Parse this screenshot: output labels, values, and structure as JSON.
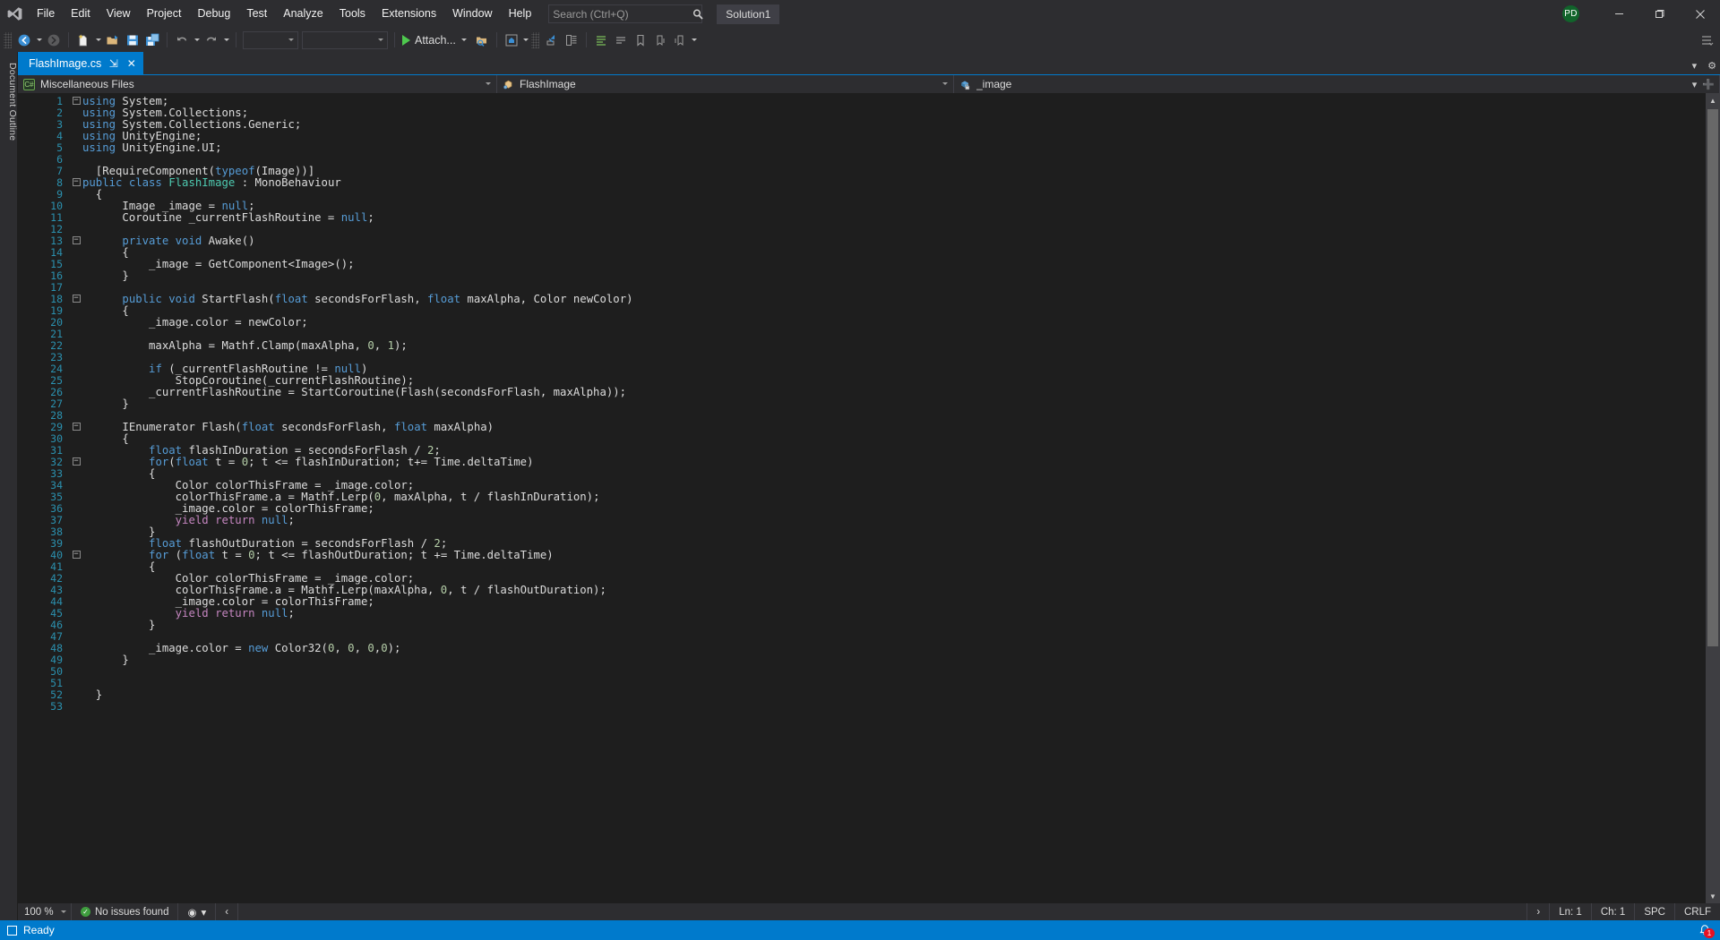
{
  "window": {
    "title": "Solution1",
    "user_initials": "PD",
    "minimize": "─",
    "maximize": "❐",
    "close": "✕"
  },
  "menu": {
    "items": [
      "File",
      "Edit",
      "View",
      "Project",
      "Debug",
      "Test",
      "Analyze",
      "Tools",
      "Extensions",
      "Window",
      "Help"
    ]
  },
  "search": {
    "placeholder": "Search (Ctrl+Q)",
    "value": ""
  },
  "toolbar": {
    "navigate_back": "navigate-backward",
    "navigate_forward": "navigate-forward",
    "new_project": "new-project",
    "open_file": "open-file",
    "save": "save",
    "save_all": "save-all",
    "undo": "undo",
    "redo": "redo",
    "combo1": "",
    "combo2": "",
    "attach_label": "Attach...",
    "hot_reload": "hot-reload",
    "preview": "preview-selected-items",
    "solution_explorer": "solution-explorer",
    "properties": "properties-window",
    "toolbox": "toolbox"
  },
  "tabs": [
    {
      "label": "FlashImage.cs",
      "pin": "⇲",
      "close": "✕",
      "active": true
    }
  ],
  "navbar": {
    "project": "Miscellaneous Files",
    "type": "FlashImage",
    "member": "_image"
  },
  "editor": {
    "lines": [
      {
        "n": 1,
        "fold": "minus",
        "tokens": [
          [
            "k",
            "using"
          ],
          [
            "w",
            " System;"
          ]
        ]
      },
      {
        "n": 2,
        "fold": "bar",
        "tokens": [
          [
            "k",
            "using"
          ],
          [
            "w",
            " System.Collections;"
          ]
        ]
      },
      {
        "n": 3,
        "fold": "bar",
        "tokens": [
          [
            "k",
            "using"
          ],
          [
            "w",
            " System.Collections.Generic;"
          ]
        ]
      },
      {
        "n": 4,
        "fold": "bar",
        "tokens": [
          [
            "k",
            "using"
          ],
          [
            "w",
            " UnityEngine;"
          ]
        ]
      },
      {
        "n": 5,
        "fold": "barend",
        "tokens": [
          [
            "k",
            "using"
          ],
          [
            "w",
            " UnityEngine.UI;"
          ]
        ]
      },
      {
        "n": 6,
        "fold": "",
        "tokens": []
      },
      {
        "n": 7,
        "fold": "",
        "tokens": [
          [
            "w",
            "  [RequireComponent("
          ],
          [
            "k",
            "typeof"
          ],
          [
            "w",
            "(Image))]"
          ]
        ]
      },
      {
        "n": 8,
        "fold": "minus",
        "tokens": [
          [
            "k",
            "public class "
          ],
          [
            "t",
            "FlashImage"
          ],
          [
            "w",
            " : MonoBehaviour"
          ]
        ]
      },
      {
        "n": 9,
        "fold": "",
        "tokens": [
          [
            "w",
            "  {"
          ]
        ]
      },
      {
        "n": 10,
        "fold": "",
        "tokens": [
          [
            "w",
            "      Image _image = "
          ],
          [
            "k",
            "null"
          ],
          [
            "w",
            ";"
          ]
        ]
      },
      {
        "n": 11,
        "fold": "",
        "tokens": [
          [
            "w",
            "      Coroutine _currentFlashRoutine = "
          ],
          [
            "k",
            "null"
          ],
          [
            "w",
            ";"
          ]
        ]
      },
      {
        "n": 12,
        "fold": "",
        "tokens": []
      },
      {
        "n": 13,
        "fold": "minus",
        "tokens": [
          [
            "k",
            "      private void "
          ],
          [
            "w",
            "Awake()"
          ]
        ]
      },
      {
        "n": 14,
        "fold": "",
        "tokens": [
          [
            "w",
            "      {"
          ]
        ]
      },
      {
        "n": 15,
        "fold": "",
        "tokens": [
          [
            "w",
            "          _image = GetComponent<Image>();"
          ]
        ]
      },
      {
        "n": 16,
        "fold": "",
        "tokens": [
          [
            "w",
            "      }"
          ]
        ]
      },
      {
        "n": 17,
        "fold": "",
        "tokens": []
      },
      {
        "n": 18,
        "fold": "minus",
        "tokens": [
          [
            "k",
            "      public void "
          ],
          [
            "w",
            "StartFlash("
          ],
          [
            "k",
            "float"
          ],
          [
            "w",
            " secondsForFlash, "
          ],
          [
            "k",
            "float"
          ],
          [
            "w",
            " maxAlpha, Color newColor)"
          ]
        ]
      },
      {
        "n": 19,
        "fold": "",
        "tokens": [
          [
            "w",
            "      {"
          ]
        ]
      },
      {
        "n": 20,
        "fold": "",
        "tokens": [
          [
            "w",
            "          _image.color = newColor;"
          ]
        ]
      },
      {
        "n": 21,
        "fold": "",
        "tokens": []
      },
      {
        "n": 22,
        "fold": "",
        "tokens": [
          [
            "w",
            "          maxAlpha = Mathf.Clamp(maxAlpha, "
          ],
          [
            "n",
            "0"
          ],
          [
            "w",
            ", "
          ],
          [
            "n",
            "1"
          ],
          [
            "w",
            ");"
          ]
        ]
      },
      {
        "n": 23,
        "fold": "",
        "tokens": []
      },
      {
        "n": 24,
        "fold": "",
        "tokens": [
          [
            "w",
            "          "
          ],
          [
            "k",
            "if"
          ],
          [
            "w",
            " (_currentFlashRoutine != "
          ],
          [
            "k",
            "null"
          ],
          [
            "w",
            ")"
          ]
        ]
      },
      {
        "n": 25,
        "fold": "",
        "tokens": [
          [
            "w",
            "              StopCoroutine(_currentFlashRoutine);"
          ]
        ]
      },
      {
        "n": 26,
        "fold": "",
        "tokens": [
          [
            "w",
            "          _currentFlashRoutine = StartCoroutine(Flash(secondsForFlash, maxAlpha));"
          ]
        ]
      },
      {
        "n": 27,
        "fold": "",
        "tokens": [
          [
            "w",
            "      }"
          ]
        ]
      },
      {
        "n": 28,
        "fold": "",
        "tokens": []
      },
      {
        "n": 29,
        "fold": "minus",
        "tokens": [
          [
            "w",
            "      IEnumerator Flash("
          ],
          [
            "k",
            "float"
          ],
          [
            "w",
            " secondsForFlash, "
          ],
          [
            "k",
            "float"
          ],
          [
            "w",
            " maxAlpha)"
          ]
        ]
      },
      {
        "n": 30,
        "fold": "",
        "tokens": [
          [
            "w",
            "      {"
          ]
        ]
      },
      {
        "n": 31,
        "fold": "",
        "tokens": [
          [
            "w",
            "          "
          ],
          [
            "k",
            "float"
          ],
          [
            "w",
            " flashInDuration = secondsForFlash / "
          ],
          [
            "n",
            "2"
          ],
          [
            "w",
            ";"
          ]
        ]
      },
      {
        "n": 32,
        "fold": "minus",
        "tokens": [
          [
            "w",
            "          "
          ],
          [
            "k",
            "for"
          ],
          [
            "w",
            "("
          ],
          [
            "k",
            "float"
          ],
          [
            "w",
            " t = "
          ],
          [
            "n",
            "0"
          ],
          [
            "w",
            "; t <= flashInDuration; t+= Time.deltaTime)"
          ]
        ]
      },
      {
        "n": 33,
        "fold": "",
        "tokens": [
          [
            "w",
            "          {"
          ]
        ]
      },
      {
        "n": 34,
        "fold": "",
        "tokens": [
          [
            "w",
            "              Color colorThisFrame = _image.color;"
          ]
        ]
      },
      {
        "n": 35,
        "fold": "",
        "tokens": [
          [
            "w",
            "              colorThisFrame.a = Mathf.Lerp("
          ],
          [
            "n",
            "0"
          ],
          [
            "w",
            ", maxAlpha, t / flashInDuration);"
          ]
        ]
      },
      {
        "n": 36,
        "fold": "",
        "tokens": [
          [
            "w",
            "              _image.color = colorThisFrame;"
          ]
        ]
      },
      {
        "n": 37,
        "fold": "",
        "tokens": [
          [
            "w",
            "              "
          ],
          [
            "p",
            "yield return "
          ],
          [
            "k",
            "null"
          ],
          [
            "w",
            ";"
          ]
        ]
      },
      {
        "n": 38,
        "fold": "",
        "tokens": [
          [
            "w",
            "          }"
          ]
        ]
      },
      {
        "n": 39,
        "fold": "",
        "tokens": [
          [
            "w",
            "          "
          ],
          [
            "k",
            "float"
          ],
          [
            "w",
            " flashOutDuration = secondsForFlash / "
          ],
          [
            "n",
            "2"
          ],
          [
            "w",
            ";"
          ]
        ]
      },
      {
        "n": 40,
        "fold": "minus",
        "tokens": [
          [
            "w",
            "          "
          ],
          [
            "k",
            "for"
          ],
          [
            "w",
            " ("
          ],
          [
            "k",
            "float"
          ],
          [
            "w",
            " t = "
          ],
          [
            "n",
            "0"
          ],
          [
            "w",
            "; t <= flashOutDuration; t += Time.deltaTime)"
          ]
        ]
      },
      {
        "n": 41,
        "fold": "",
        "tokens": [
          [
            "w",
            "          {"
          ]
        ]
      },
      {
        "n": 42,
        "fold": "",
        "tokens": [
          [
            "w",
            "              Color colorThisFrame = _image.color;"
          ]
        ]
      },
      {
        "n": 43,
        "fold": "",
        "tokens": [
          [
            "w",
            "              colorThisFrame.a = Mathf.Lerp(maxAlpha, "
          ],
          [
            "n",
            "0"
          ],
          [
            "w",
            ", t / flashOutDuration);"
          ]
        ]
      },
      {
        "n": 44,
        "fold": "",
        "tokens": [
          [
            "w",
            "              _image.color = colorThisFrame;"
          ]
        ]
      },
      {
        "n": 45,
        "fold": "",
        "tokens": [
          [
            "w",
            "              "
          ],
          [
            "p",
            "yield return "
          ],
          [
            "k",
            "null"
          ],
          [
            "w",
            ";"
          ]
        ]
      },
      {
        "n": 46,
        "fold": "",
        "tokens": [
          [
            "w",
            "          }"
          ]
        ]
      },
      {
        "n": 47,
        "fold": "",
        "tokens": []
      },
      {
        "n": 48,
        "fold": "",
        "tokens": [
          [
            "w",
            "          _image.color = "
          ],
          [
            "k",
            "new"
          ],
          [
            "w",
            " Color32("
          ],
          [
            "n",
            "0"
          ],
          [
            "w",
            ", "
          ],
          [
            "n",
            "0"
          ],
          [
            "w",
            ", "
          ],
          [
            "n",
            "0"
          ],
          [
            "w",
            ","
          ],
          [
            "n",
            "0"
          ],
          [
            "w",
            ");"
          ]
        ]
      },
      {
        "n": 49,
        "fold": "",
        "tokens": [
          [
            "w",
            "      }"
          ]
        ]
      },
      {
        "n": 50,
        "fold": "",
        "tokens": []
      },
      {
        "n": 51,
        "fold": "",
        "tokens": []
      },
      {
        "n": 52,
        "fold": "",
        "tokens": [
          [
            "w",
            "  }"
          ]
        ]
      },
      {
        "n": 53,
        "fold": "",
        "tokens": []
      }
    ]
  },
  "edit_status": {
    "zoom": "100 %",
    "issues": "No issues found",
    "line": "Ln: 1",
    "col": "Ch: 1",
    "spaces": "SPC",
    "eol": "CRLF"
  },
  "statusbar": {
    "ready": "Ready",
    "notification_count": "1"
  },
  "left_rail": {
    "document_outline": "Document Outline"
  },
  "colors": {
    "accent": "#007acc",
    "chrome": "#2d2d30",
    "editor_bg": "#1e1e1e",
    "keyword": "#569cd6",
    "type": "#4ec9b0",
    "linenum": "#2b91af",
    "control": "#c586c0",
    "number": "#b5cea8"
  }
}
